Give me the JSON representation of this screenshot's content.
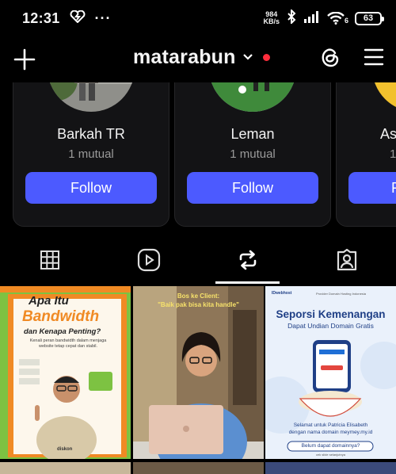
{
  "status_bar": {
    "time": "12:31",
    "net_speed": "984",
    "net_unit": "KB/s",
    "signal_label": "6",
    "battery": "63"
  },
  "header": {
    "username": "matarabun"
  },
  "suggestions": [
    {
      "name": "Barkah TR",
      "mutual": "1 mutual",
      "button": "Follow"
    },
    {
      "name": "Leman",
      "mutual": "1 mutual",
      "button": "Follow"
    },
    {
      "name": "As",
      "mutual": "1",
      "button": "F"
    }
  ],
  "tabs": [
    "grid",
    "reels",
    "reposts",
    "tagged"
  ],
  "posts": {
    "p1": {
      "title_1": "Apa Itu",
      "title_2": "Bandwidth",
      "title_3": "dan Kenapa Penting?",
      "body": "Kenali peran bandwidth dalam menjaga website tetap cepat dan stabil.",
      "brand": "diskon"
    },
    "p2": {
      "line_1": "Bos ke Client:",
      "line_2": "\"Baik pak bisa kita handle\""
    },
    "p3": {
      "brand": "IDwebhost",
      "tagline": "Provider Domain Hosting Indonesia",
      "title_1": "Seporsi Kemenangan",
      "title_2": "Dapat Undian Domain Gratis",
      "winner_1": "Selamat untuk Patricia Elisabeth",
      "winner_2": "dengan nama domain meymey.my.id",
      "cta": "Belum dapat domainnya?",
      "footer": "cek slide selanjutnya"
    }
  },
  "colors": {
    "accent_button": "#4c5aff",
    "notification_dot": "#ff2d3c",
    "bandwidth_green": "#7dc242",
    "bandwidth_orange": "#f08a24"
  }
}
